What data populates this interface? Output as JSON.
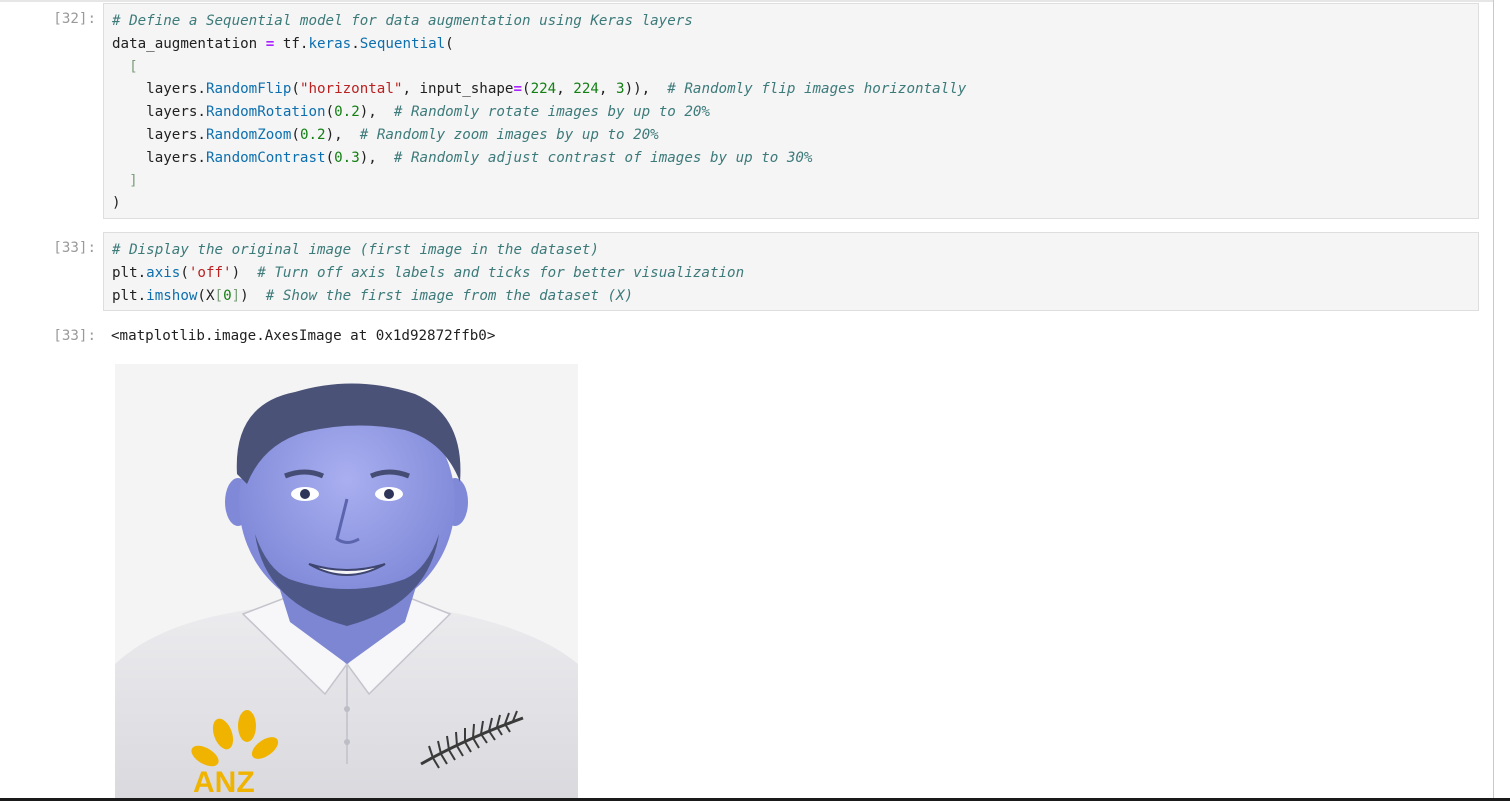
{
  "cells": [
    {
      "prompt": "[32]:",
      "lines": [
        "# Define a Sequential model for data augmentation using Keras layers",
        "data_augmentation = tf.keras.Sequential(",
        "  [",
        "    layers.RandomFlip(\"horizontal\", input_shape=(224, 224, 3)),  # Randomly flip images horizontally",
        "    layers.RandomRotation(0.2),  # Randomly rotate images by up to 20%",
        "    layers.RandomZoom(0.2),  # Randomly zoom images by up to 20%",
        "    layers.RandomContrast(0.3),  # Randomly adjust contrast of images by up to 30%",
        "  ]",
        ")"
      ]
    },
    {
      "prompt": "[33]:",
      "lines": [
        "# Display the original image (first image in the dataset)",
        "plt.axis('off')  # Turn off axis labels and ticks for better visualization",
        "plt.imshow(X[0])  # Show the first image from the dataset (X)"
      ]
    }
  ],
  "output": {
    "prompt": "[33]:",
    "text": "<matplotlib.image.AxesImage at 0x1d92872ffb0>",
    "image_logo_text": "ANZ"
  },
  "colors": {
    "cell_bg": "#f5f5f5",
    "prompt": "#9a9a9a",
    "comment": "#3d7a7a",
    "function": "#0d6fae",
    "string": "#ba2121",
    "number": "#148014",
    "operator": "#aa22ff",
    "skin_tint": "#8a93dd",
    "logo": "#f0b400"
  },
  "icons": [
    "image-output"
  ]
}
